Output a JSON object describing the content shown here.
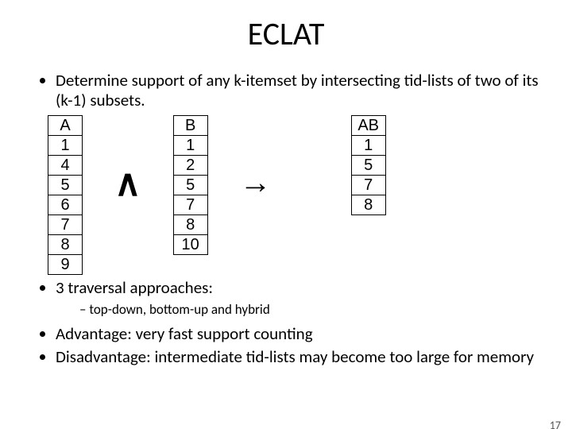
{
  "title": "ECLAT",
  "bullets": {
    "b1": "Determine support of any k-itemset by intersecting tid-lists of two of its (k-1) subsets.",
    "b2": "3 traversal approaches:",
    "b2_sub": "top-down, bottom-up and hybrid",
    "b3": "Advantage: very fast support counting",
    "b4": "Disadvantage: intermediate tid-lists may become too large for memory"
  },
  "operators": {
    "intersect": "∧",
    "arrow": "→"
  },
  "tables": {
    "A": {
      "header": "A",
      "rows": [
        "1",
        "4",
        "5",
        "6",
        "7",
        "8",
        "9"
      ]
    },
    "B": {
      "header": "B",
      "rows": [
        "1",
        "2",
        "5",
        "7",
        "8",
        "10"
      ]
    },
    "AB": {
      "header": "AB",
      "rows": [
        "1",
        "5",
        "7",
        "8"
      ]
    }
  },
  "page_number": "17"
}
